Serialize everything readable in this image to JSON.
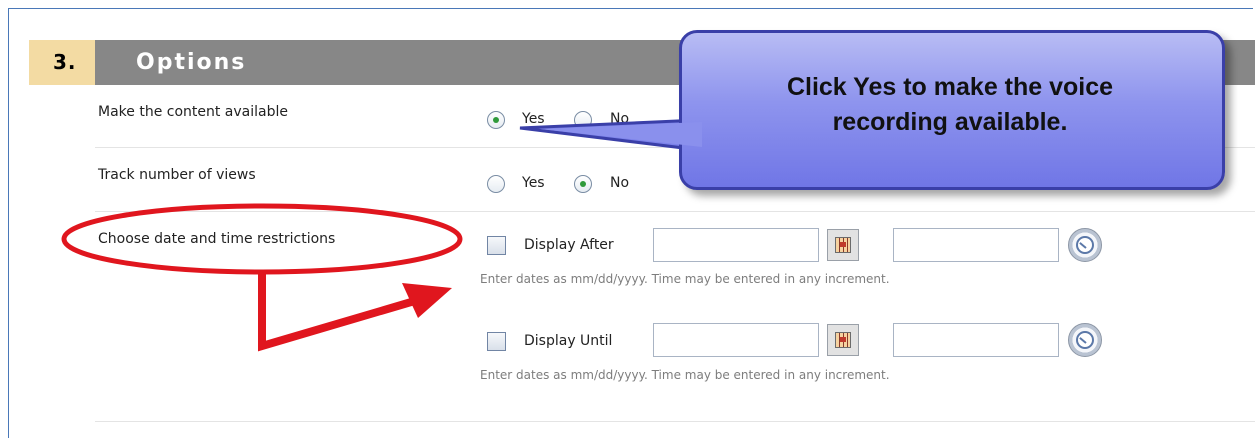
{
  "section": {
    "number": "3.",
    "title": "Options"
  },
  "rows": {
    "available": {
      "label": "Make the content available",
      "yes_label": "Yes",
      "no_label": "No",
      "selected": "Yes"
    },
    "track": {
      "label": "Track number of views",
      "yes_label": "Yes",
      "no_label": "No",
      "selected": "No"
    },
    "restrictions": {
      "label": "Choose date and time restrictions",
      "display_after": {
        "label": "Display After",
        "checked": false,
        "date_value": "",
        "time_value": "",
        "hint": "Enter dates as mm/dd/yyyy. Time may be entered in any increment."
      },
      "display_until": {
        "label": "Display Until",
        "checked": false,
        "date_value": "",
        "time_value": "",
        "hint": "Enter dates as mm/dd/yyyy. Time may be entered in any increment."
      }
    }
  },
  "callout": {
    "line1": "Click Yes to make the voice",
    "line2": "recording available."
  },
  "icons": {
    "calendar": "calendar-icon",
    "clock": "clock-icon"
  },
  "colors": {
    "header_bg": "#878787",
    "step_bg": "#f3dba3",
    "callout_fill": "#8e94ee",
    "callout_border": "#3a3fa8",
    "annotation_red": "#e0161e",
    "radio_dot": "#2f9a3a"
  }
}
